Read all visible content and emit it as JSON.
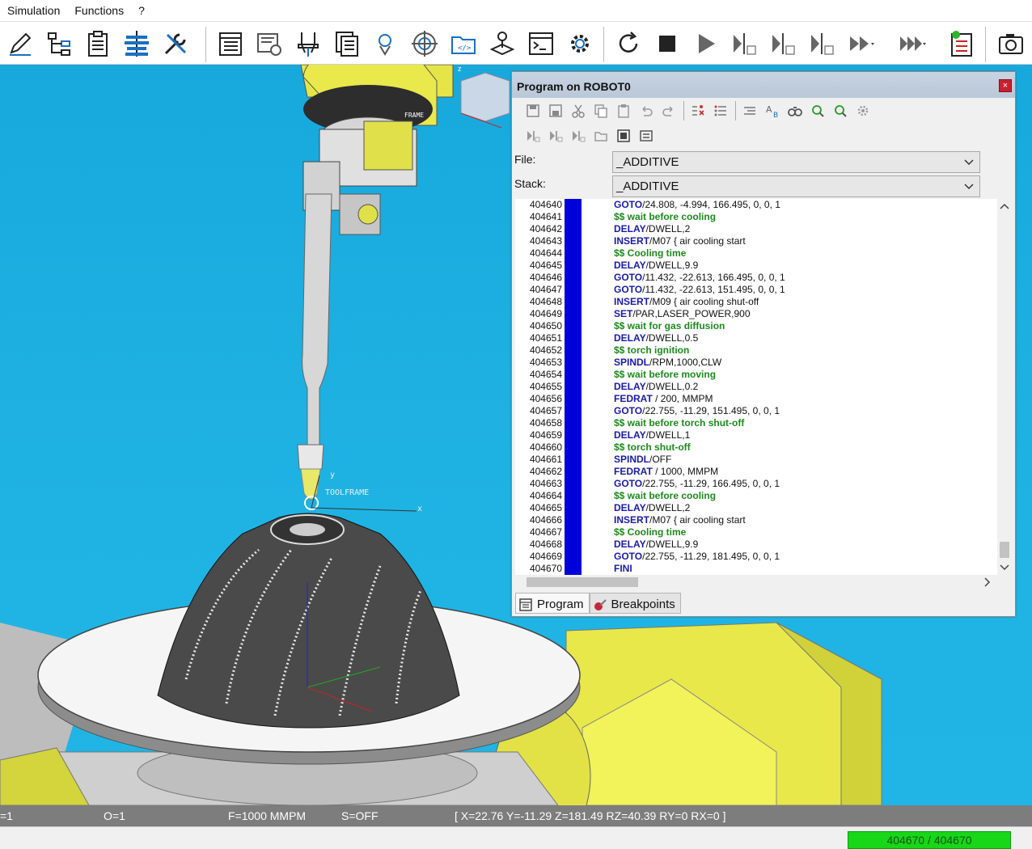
{
  "menu": {
    "simulation": "Simulation",
    "functions": "Functions",
    "help": "?"
  },
  "toolbar": {
    "icons": [
      "pencil-icon",
      "tree-icon",
      "clipboard-icon",
      "layers-icon",
      "tools-icon",
      "program-list-icon",
      "machine-info-icon",
      "cutter-icon",
      "documents-icon",
      "robot-head-icon",
      "crosshair-icon",
      "folder-code-icon",
      "joystick-icon",
      "terminal-icon",
      "gear-icon",
      "reset-icon",
      "stop-icon",
      "play-icon",
      "step-icon-1",
      "step-icon-2",
      "step-icon-3",
      "fast-forward-icon",
      "faster-forward-icon",
      "checklist-icon",
      "camera-icon"
    ]
  },
  "viewport": {
    "toolframe_label": "TOOLFRAME",
    "axis_x": "x",
    "axis_y": "y",
    "axis_z": "z",
    "frame_label": "FRAME"
  },
  "program_window": {
    "title": "Program on ROBOT0",
    "close": "×",
    "file_label": "File:",
    "file_value": "_ADDITIVE",
    "stack_label": "Stack:",
    "stack_value": "_ADDITIVE",
    "lines": [
      {
        "n": "404640",
        "kw": "GOTO",
        "rest": "/24.808, -4.994, 166.495, 0, 0, 1",
        "cmt": false
      },
      {
        "n": "404641",
        "kw": "",
        "rest": "$$ wait before cooling",
        "cmt": true
      },
      {
        "n": "404642",
        "kw": "DELAY",
        "rest": "/DWELL,2",
        "cmt": false
      },
      {
        "n": "404643",
        "kw": "INSERT",
        "rest": "/M07 { air cooling start",
        "cmt": false
      },
      {
        "n": "404644",
        "kw": "",
        "rest": "$$ Cooling time",
        "cmt": true
      },
      {
        "n": "404645",
        "kw": "DELAY",
        "rest": "/DWELL,9.9",
        "cmt": false
      },
      {
        "n": "404646",
        "kw": "GOTO",
        "rest": "/11.432, -22.613, 166.495, 0, 0, 1",
        "cmt": false
      },
      {
        "n": "404647",
        "kw": "GOTO",
        "rest": "/11.432, -22.613, 151.495, 0, 0, 1",
        "cmt": false
      },
      {
        "n": "404648",
        "kw": "INSERT",
        "rest": "/M09 { air cooling shut-off",
        "cmt": false
      },
      {
        "n": "404649",
        "kw": "SET",
        "rest": "/PAR,LASER_POWER,900",
        "cmt": false
      },
      {
        "n": "404650",
        "kw": "",
        "rest": "$$ wait for gas diffusion",
        "cmt": true
      },
      {
        "n": "404651",
        "kw": "DELAY",
        "rest": "/DWELL,0.5",
        "cmt": false
      },
      {
        "n": "404652",
        "kw": "",
        "rest": "$$ torch ignition",
        "cmt": true
      },
      {
        "n": "404653",
        "kw": "SPINDL",
        "rest": "/RPM,1000,CLW",
        "cmt": false
      },
      {
        "n": "404654",
        "kw": "",
        "rest": "$$ wait before moving",
        "cmt": true
      },
      {
        "n": "404655",
        "kw": "DELAY",
        "rest": "/DWELL,0.2",
        "cmt": false
      },
      {
        "n": "404656",
        "kw": "FEDRAT",
        "rest": " / 200, MMPM",
        "cmt": false
      },
      {
        "n": "404657",
        "kw": "GOTO",
        "rest": "/22.755, -11.29, 151.495, 0, 0, 1",
        "cmt": false
      },
      {
        "n": "404658",
        "kw": "",
        "rest": "$$ wait before torch shut-off",
        "cmt": true
      },
      {
        "n": "404659",
        "kw": "DELAY",
        "rest": "/DWELL,1",
        "cmt": false
      },
      {
        "n": "404660",
        "kw": "",
        "rest": "$$ torch shut-off",
        "cmt": true
      },
      {
        "n": "404661",
        "kw": "SPINDL",
        "rest": "/OFF",
        "cmt": false
      },
      {
        "n": "404662",
        "kw": "FEDRAT",
        "rest": " / 1000, MMPM",
        "cmt": false
      },
      {
        "n": "404663",
        "kw": "GOTO",
        "rest": "/22.755, -11.29, 166.495, 0, 0, 1",
        "cmt": false
      },
      {
        "n": "404664",
        "kw": "",
        "rest": "$$ wait before cooling",
        "cmt": true
      },
      {
        "n": "404665",
        "kw": "DELAY",
        "rest": "/DWELL,2",
        "cmt": false
      },
      {
        "n": "404666",
        "kw": "INSERT",
        "rest": "/M07 { air cooling start",
        "cmt": false
      },
      {
        "n": "404667",
        "kw": "",
        "rest": "$$ Cooling time",
        "cmt": true
      },
      {
        "n": "404668",
        "kw": "DELAY",
        "rest": "/DWELL,9.9",
        "cmt": false
      },
      {
        "n": "404669",
        "kw": "GOTO",
        "rest": "/22.755, -11.29, 181.495, 0, 0, 1",
        "cmt": false
      },
      {
        "n": "404670",
        "kw": "FINI",
        "rest": "",
        "cmt": false
      }
    ],
    "tabs": {
      "program": "Program",
      "breakpoints": "Breakpoints"
    }
  },
  "status": {
    "t": "=1",
    "o": "O=1",
    "feed": "F=1000 MMPM",
    "spindle": "S=OFF",
    "coords": "[ X=22.76 Y=-11.29 Z=181.49 RZ=40.39 RY=0 RX=0 ]",
    "progress": "404670 / 404670"
  }
}
